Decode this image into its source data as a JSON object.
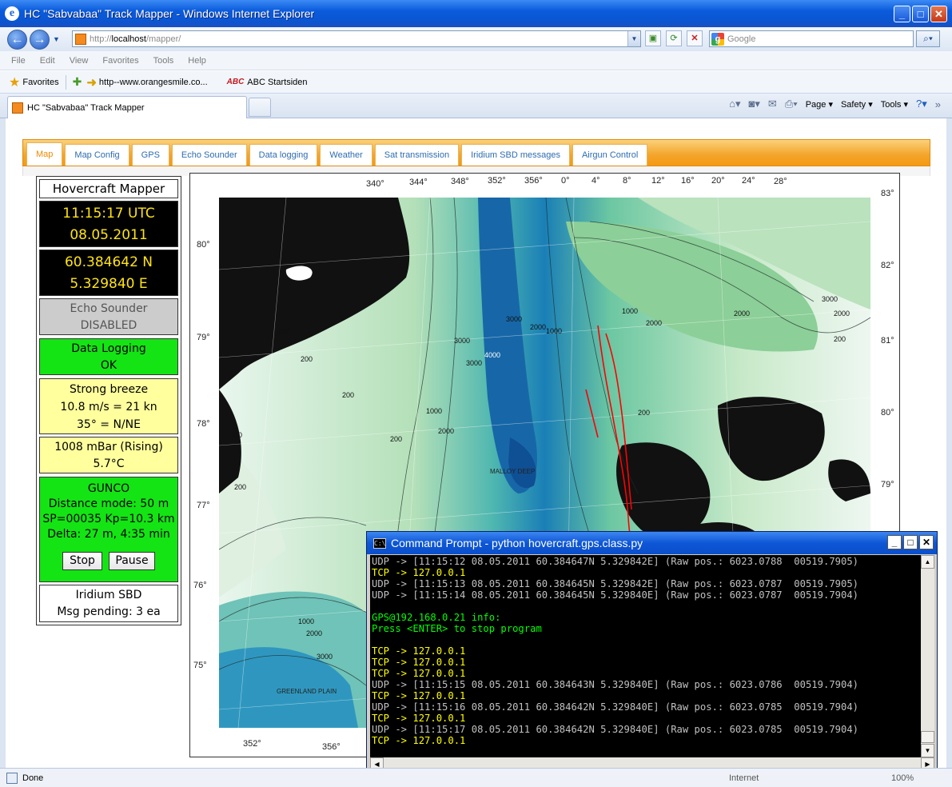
{
  "window": {
    "title": "HC \"Sabvabaa\" Track Mapper - Windows Internet Explorer"
  },
  "address": {
    "scheme": "http://",
    "host": "localhost",
    "path": "/mapper/"
  },
  "search": {
    "placeholder": "Google"
  },
  "menu": [
    "File",
    "Edit",
    "View",
    "Favorites",
    "Tools",
    "Help"
  ],
  "favorites": {
    "label": "Favorites",
    "link1": "http--www.orangesmile.co...",
    "link2": "ABC Startsiden",
    "abc_icon": "ABC"
  },
  "browser_tab": {
    "title": "HC \"Sabvabaa\" Track Mapper"
  },
  "commandbar": {
    "page": "Page",
    "safety": "Safety",
    "tools": "Tools"
  },
  "app_tabs": [
    "Map",
    "Map Config",
    "GPS",
    "Echo Sounder",
    "Data logging",
    "Weather",
    "Sat transmission",
    "Iridium SBD messages",
    "Airgun Control"
  ],
  "panel": {
    "title": "Hovercraft Mapper",
    "time": "11:15:17 UTC",
    "date": "08.05.2011",
    "lat": "60.384642 N",
    "lon": "5.329840 E",
    "echo_title": "Echo Sounder",
    "echo_status": "DISABLED",
    "log_title": "Data Logging",
    "log_status": "OK",
    "wind_desc": "Strong breeze",
    "wind_speed": "10.8 m/s = 21 kn",
    "wind_dir": "35° = N/NE",
    "pressure": "1008 mBar (Rising)",
    "temp": "5.7°C",
    "gun_title": "GUNCO",
    "gun_mode": "Distance mode: 50 m",
    "gun_sp": "SP=00035 Kp=10.3 km",
    "gun_delta": "Delta: 27 m, 4:35 min",
    "stop": "Stop",
    "pause": "Pause",
    "irid_title": "Iridium SBD",
    "irid_status": "Msg pending: 3 ea"
  },
  "map": {
    "top_lon_labels": [
      "340°",
      "344°",
      "348°",
      "352°",
      "356°",
      "0°",
      "4°",
      "8°",
      "12°",
      "16°",
      "20°",
      "24°",
      "28°"
    ],
    "left_lat_labels": [
      "80°",
      "79°",
      "78°",
      "77°",
      "76°",
      "75°"
    ],
    "right_lat_labels": [
      "83°",
      "82°",
      "81°",
      "80°",
      "79°"
    ],
    "bottom_lon_labels": [
      "352°",
      "356°"
    ],
    "place_labels": [
      "MALLOY DEEP",
      "GREENLAND PLAIN"
    ],
    "depth_labels": [
      "200",
      "200",
      "200",
      "200",
      "200",
      "200",
      "1000",
      "2000",
      "3000",
      "4000",
      "3000",
      "3000",
      "2000",
      "1000",
      "1000",
      "2000",
      "3000",
      "2000",
      "200",
      "200",
      "1000",
      "2000",
      "3000",
      "2000"
    ],
    "colors": {
      "deep": "#1a7fb6",
      "mid": "#4fb7b0",
      "shelf": "#9ed6a4",
      "shallow": "#d9eedc",
      "land": "#111111",
      "track": "#ff0000"
    }
  },
  "console": {
    "title": "Command Prompt - python hovercraft.gps.class.py",
    "icon": "C:\\",
    "lines": [
      {
        "t": "UDP -> [11:15:12 08.05.2011 60.384647N 5.329842E] (Raw pos.: 6023.0788  00519.7905)",
        "c": "w"
      },
      {
        "t": "TCP -> 127.0.0.1",
        "c": "y"
      },
      {
        "t": "UDP -> [11:15:13 08.05.2011 60.384645N 5.329842E] (Raw pos.: 6023.0787  00519.7905)",
        "c": "w"
      },
      {
        "t": "UDP -> [11:15:14 08.05.2011 60.384645N 5.329840E] (Raw pos.: 6023.0787  00519.7904)",
        "c": "w"
      },
      {
        "t": "",
        "c": "w"
      },
      {
        "t": "GPS@192.168.0.21 info:",
        "c": "g"
      },
      {
        "t": "Press <ENTER> to stop program",
        "c": "g"
      },
      {
        "t": "",
        "c": "w"
      },
      {
        "t": "TCP -> 127.0.0.1",
        "c": "y"
      },
      {
        "t": "TCP -> 127.0.0.1",
        "c": "y"
      },
      {
        "t": "TCP -> 127.0.0.1",
        "c": "y"
      },
      {
        "t": "UDP -> [11:15:15 08.05.2011 60.384643N 5.329840E] (Raw pos.: 6023.0786  00519.7904)",
        "c": "w"
      },
      {
        "t": "TCP -> 127.0.0.1",
        "c": "y"
      },
      {
        "t": "UDP -> [11:15:16 08.05.2011 60.384642N 5.329840E] (Raw pos.: 6023.0785  00519.7904)",
        "c": "w"
      },
      {
        "t": "TCP -> 127.0.0.1",
        "c": "y"
      },
      {
        "t": "UDP -> [11:15:17 08.05.2011 60.384642N 5.329840E] (Raw pos.: 6023.0785  00519.7904)",
        "c": "w"
      },
      {
        "t": "TCP -> 127.0.0.1",
        "c": "y"
      }
    ]
  },
  "status": {
    "text": "Done",
    "zone": "Internet",
    "zoom": "100%"
  }
}
